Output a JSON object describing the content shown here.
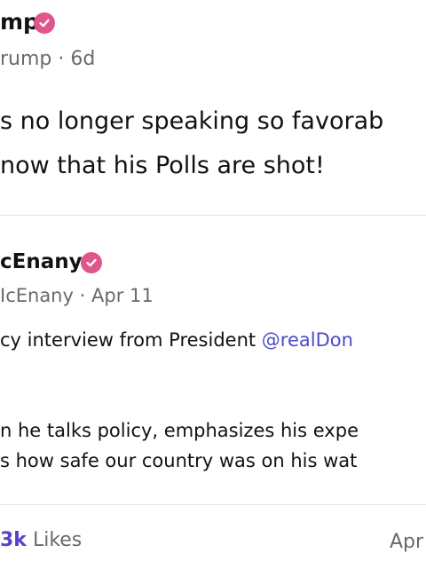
{
  "post": {
    "author_name_fragment": "mp",
    "handle_fragment": "rump",
    "time": "6d",
    "text_line1": "s no longer speaking so favorab",
    "text_line2": " now that his Polls are shot!"
  },
  "quoted": {
    "author_name_fragment": "cEnany",
    "handle_fragment": "IcEnany",
    "date": "Apr 11",
    "line1_prefix": "cy interview from President ",
    "line1_mention": "@realDon",
    "line2": "n he talks policy, emphasizes his expe",
    "line3": "s how safe our country was on his wat"
  },
  "footer": {
    "likes_count": "3k",
    "likes_label": " Likes",
    "date_fragment": "Apr"
  },
  "colors": {
    "verified_badge": "#e0568a",
    "link": "#4b4cc7",
    "likes_count": "#5b43c9"
  },
  "separator": "·"
}
